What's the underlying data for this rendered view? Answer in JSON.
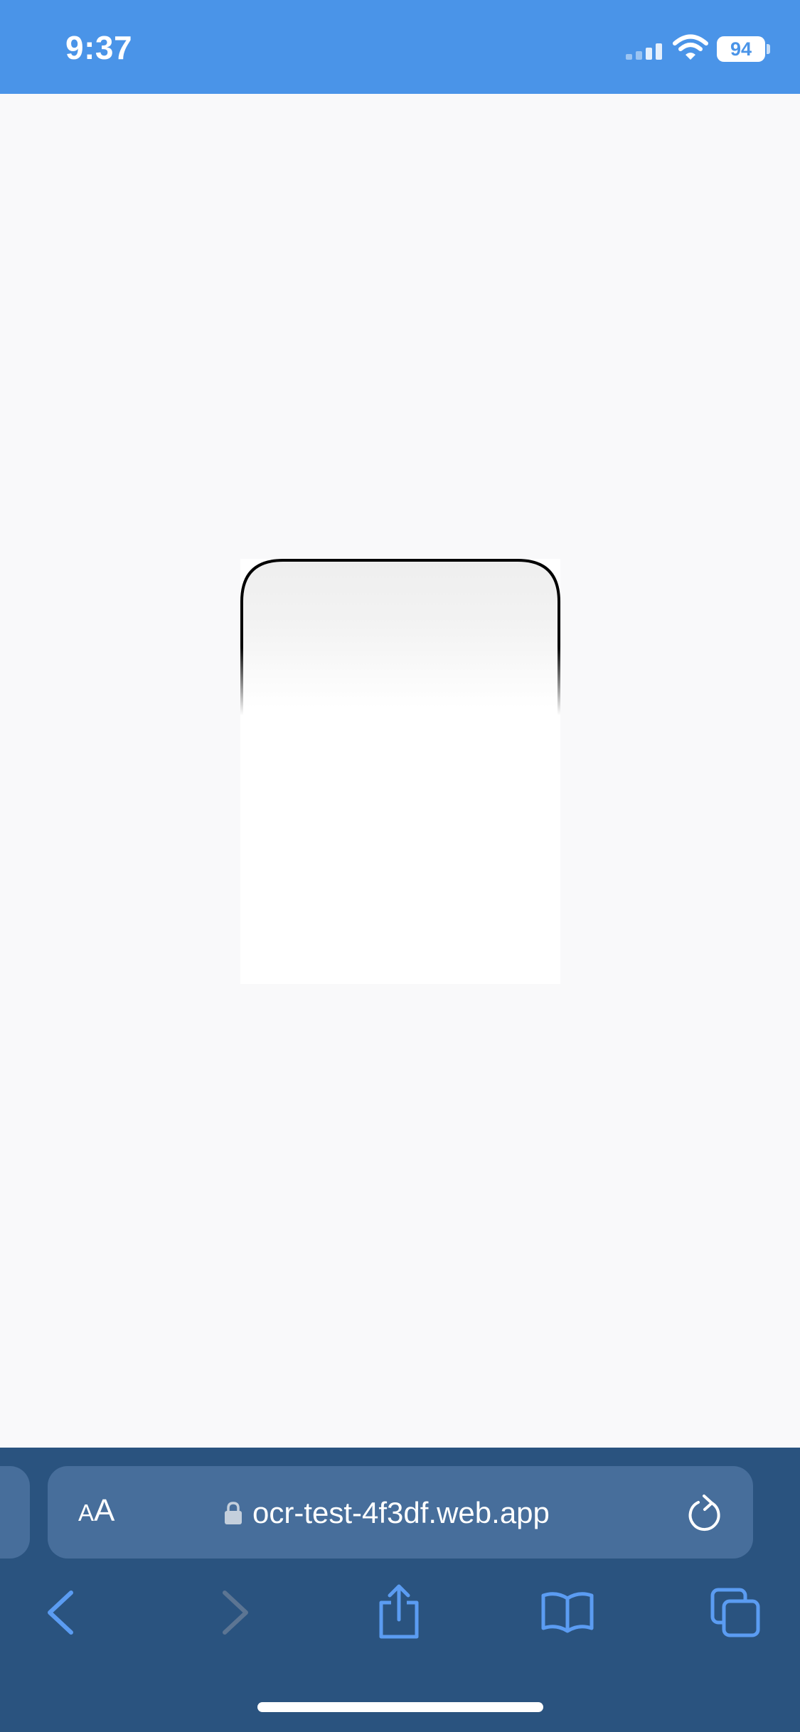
{
  "status_bar": {
    "time": "9:37",
    "battery_percent": "94",
    "background_color": "#4a94e8",
    "icons": [
      "signal-icon",
      "wifi-icon",
      "battery-icon"
    ]
  },
  "content": {
    "background_color": "#f9f9fa",
    "graphic": "phone-frame-outline"
  },
  "browser": {
    "aa_large": "A",
    "aa_small": "A",
    "url": "ocr-test-4f3df.web.app",
    "background_color": "#2a537f",
    "address_bar_color": "#476e9b",
    "accent_color": "#5b9cf2",
    "toolbar_icons": [
      "back-icon",
      "forward-icon",
      "share-icon",
      "bookmarks-icon",
      "tabs-icon"
    ]
  }
}
